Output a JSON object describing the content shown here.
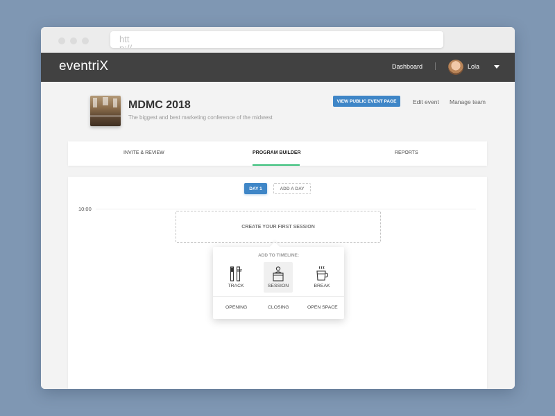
{
  "browser": {
    "url_text": "http://"
  },
  "app": {
    "logo": "eventriX",
    "nav": {
      "dashboard": "Dashboard",
      "user_name": "Lola"
    }
  },
  "event": {
    "title": "MDMC 2018",
    "subtitle": "The biggest and best marketing conference of the midwest",
    "actions": {
      "view_public": "VIEW PUBLIC EVENT PAGE",
      "edit": "Edit event",
      "manage_team": "Manage team"
    }
  },
  "tabs": [
    {
      "label": "INVITE & REVIEW",
      "active": false
    },
    {
      "label": "PROGRAM BUILDER",
      "active": true
    },
    {
      "label": "REPORTS",
      "active": false
    }
  ],
  "builder": {
    "days": {
      "day1": "DAY 1",
      "add_day": "ADD A DAY"
    },
    "time": "10:00",
    "placeholder": "CREATE YOUR FIRST SESSION",
    "popup": {
      "title": "ADD TO TIMELINE:",
      "options": [
        {
          "label": "TRACK",
          "icon": "track-icon"
        },
        {
          "label": "SESSION",
          "icon": "podium-icon",
          "selected": true
        },
        {
          "label": "BREAK",
          "icon": "coffee-cup-icon"
        }
      ],
      "links": {
        "opening": "OPENING",
        "closing": "CLOSING",
        "open_space": "OPEN SPACE"
      }
    }
  },
  "colors": {
    "page_background": "#7f97b3",
    "app_bar": "#414141",
    "primary_button": "#3f86c7",
    "active_tab_underline": "#39c07a"
  }
}
